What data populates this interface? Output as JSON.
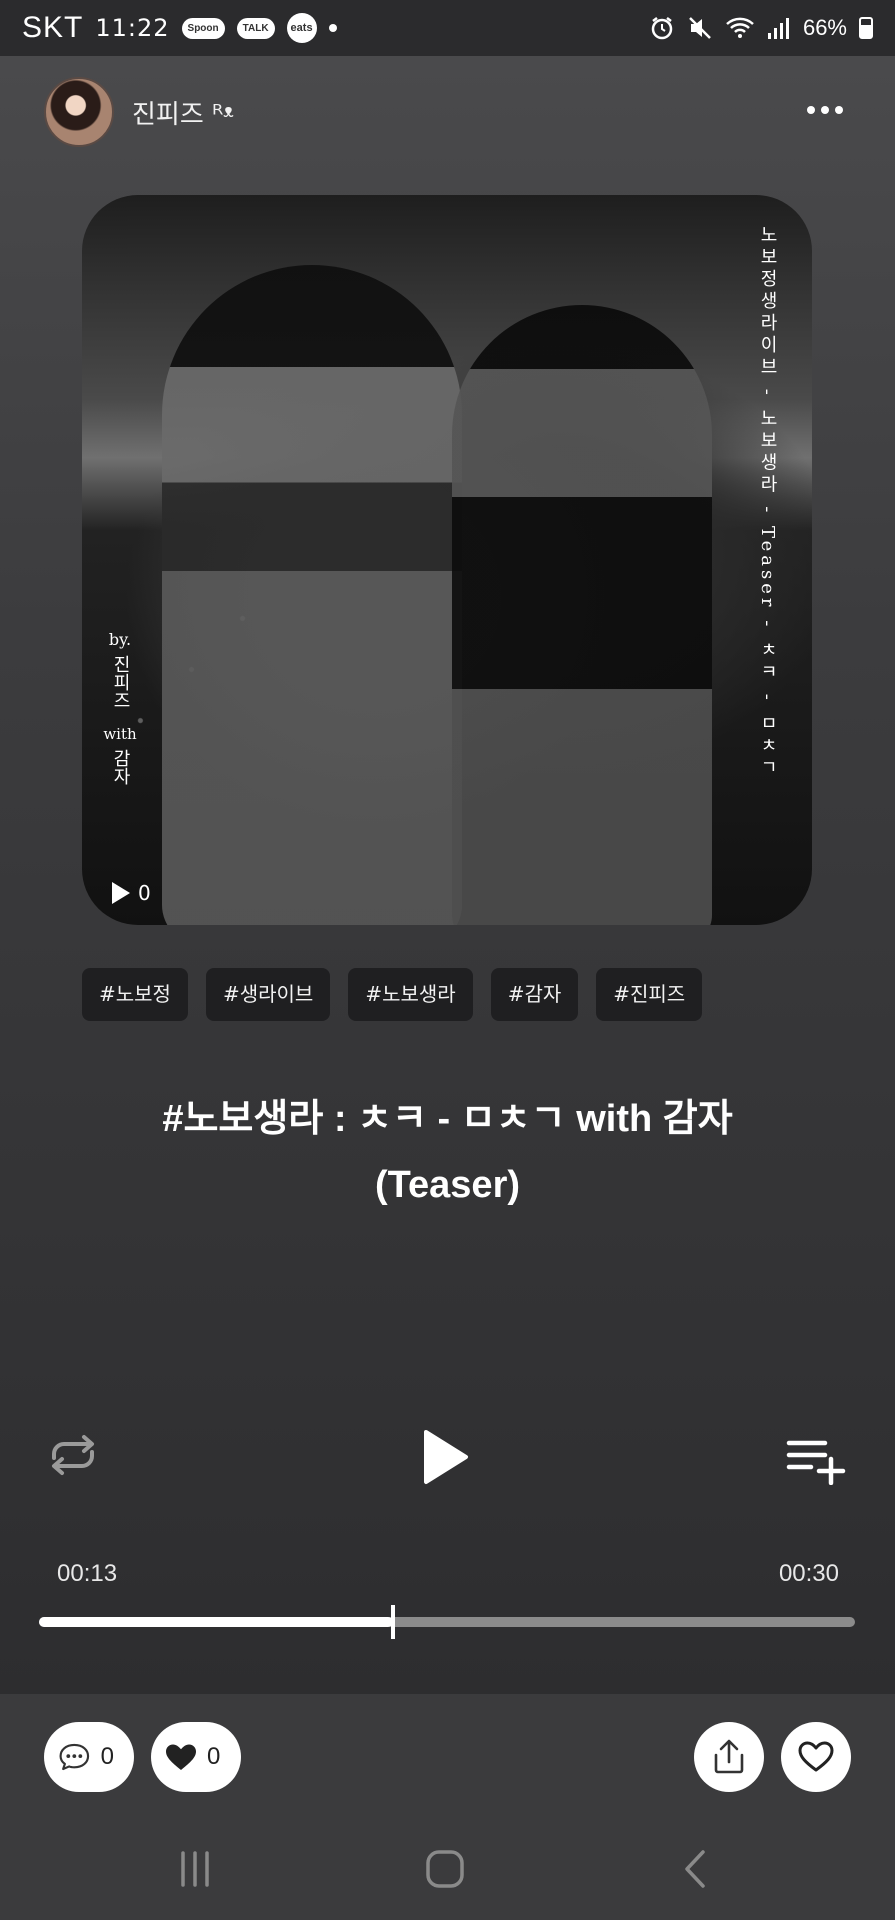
{
  "status_bar": {
    "carrier": "SKT",
    "time": "11:22",
    "app_icons": [
      "Spoon",
      "TALK",
      "eats"
    ],
    "battery": "66%",
    "icons": [
      "alarm-icon",
      "mute-icon",
      "wifi-icon",
      "signal-icon",
      "battery-icon"
    ]
  },
  "header": {
    "username": "진피즈 ᴿᵜ",
    "more_icon": "more-horizontal-icon"
  },
  "cover": {
    "vertical_text": "노보정생라이브 - 노보생라 - Teaser - ㅊㅋ - ㅁㅊㄱ",
    "credit_by": "by.",
    "credit_name1": "진피즈",
    "credit_with": "with",
    "credit_name2": "감자",
    "play_count": "0"
  },
  "tags": [
    "#노보정",
    "#생라이브",
    "#노보생라",
    "#감자",
    "#진피즈"
  ],
  "title": "#노보생라 : ㅊㅋ - ㅁㅊㄱ with 감자(Teaser)",
  "player": {
    "current_time": "00:13",
    "total_time": "00:30",
    "progress": 0.4333,
    "repeat_icon": "repeat-icon",
    "play_icon": "play-icon",
    "queue_icon": "add-to-queue-icon"
  },
  "actions": {
    "comment_count": "0",
    "like_count": "0"
  },
  "colors": {
    "background_top": "#4a4a4c",
    "background_bottom": "#2d2d2f",
    "tag_bg": "#1f1f21",
    "progress_fill": "#ffffff",
    "progress_track": "#8b8b8b"
  }
}
